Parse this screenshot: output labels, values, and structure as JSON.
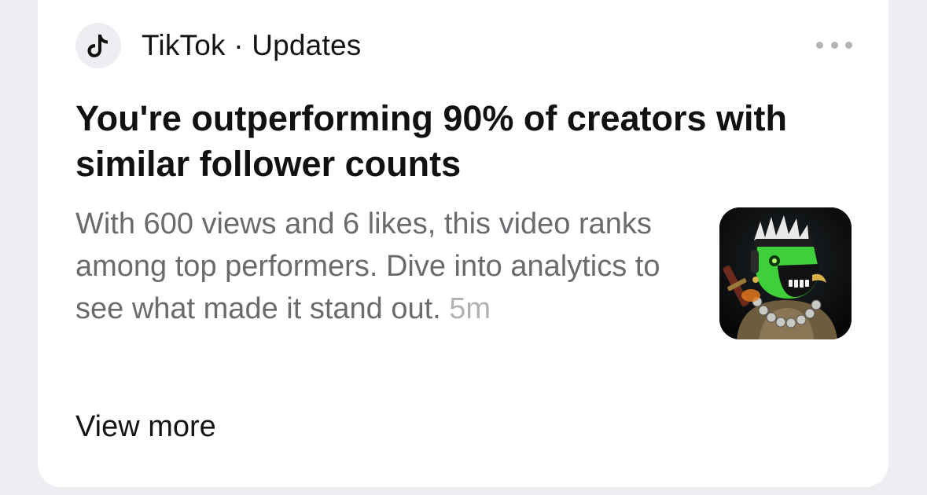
{
  "notification": {
    "app_icon": "tiktok-logo-icon",
    "app_name": "TikTok · Updates",
    "title": "You're outperforming 90% of creators with similar follower counts",
    "body": "With 600 views and 6 likes, this video ranks among top performers. Dive into analytics to see what made it stand out.",
    "timestamp": "5m",
    "thumbnail": "video-thumbnail-green-skull-character",
    "view_more_label": "View more",
    "more_options_icon": "more-horizontal-icon"
  },
  "colors": {
    "background": "#eeeef2",
    "card": "#ffffff",
    "title_text": "#111111",
    "body_text": "#6b6b6f",
    "timestamp_text": "#b2b2b6",
    "thumbnail_accent": "#3ecf3a"
  }
}
